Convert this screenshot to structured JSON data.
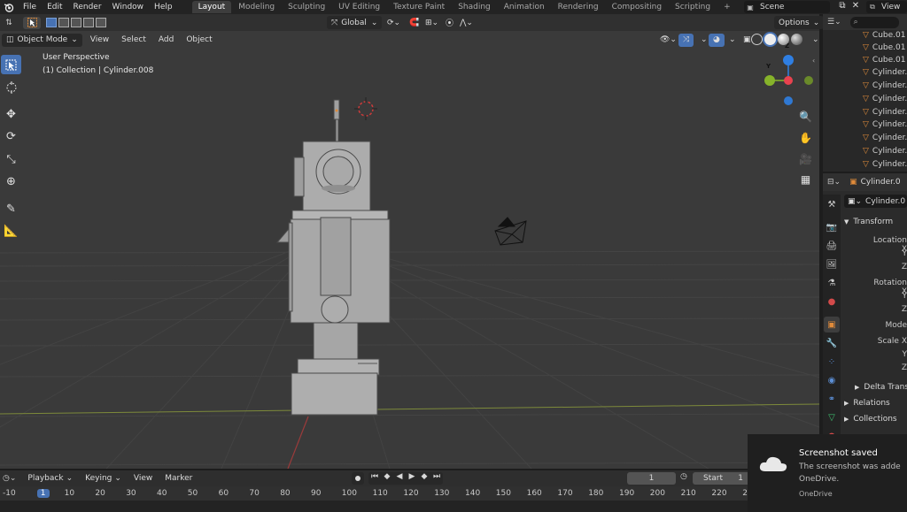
{
  "menubar": {
    "menus": [
      "File",
      "Edit",
      "Render",
      "Window",
      "Help"
    ],
    "workspaces": [
      "Layout",
      "Modeling",
      "Sculpting",
      "UV Editing",
      "Texture Paint",
      "Shading",
      "Animation",
      "Rendering",
      "Compositing",
      "Scripting"
    ],
    "add_workspace": "+",
    "scene_label": "Scene",
    "view_layer_label": "View"
  },
  "viewport_header": {
    "mode": "Object Mode",
    "menus": [
      "View",
      "Select",
      "Add",
      "Object"
    ],
    "transform_orientation": "Global",
    "options_label": "Options"
  },
  "viewport": {
    "perspective_label": "User Perspective",
    "collection_label": "(1) Collection | Cylinder.008",
    "gizmo": {
      "z": "Z",
      "y": "Y"
    }
  },
  "outliner": {
    "items": [
      "Cube.01",
      "Cube.01",
      "Cube.01",
      "Cylinder.",
      "Cylinder.",
      "Cylinder.",
      "Cylinder.",
      "Cylinder.",
      "Cylinder.",
      "Cylinder.",
      "Cylinder."
    ]
  },
  "properties": {
    "object_name_field": "Cylinder.0",
    "object_name_header": "Cylinder.0",
    "transform_label": "Transform",
    "location_x": "Location X",
    "location_y": "Y",
    "location_z": "Z",
    "rotation_x": "Rotation X",
    "rotation_y": "Y",
    "rotation_z": "Z",
    "mode_label": "Mode",
    "scale_x": "Scale X",
    "scale_y": "Y",
    "scale_z": "Z",
    "delta_transform": "Delta Transfo",
    "relations": "Relations",
    "collections": "Collections"
  },
  "timeline": {
    "menus": [
      "Playback",
      "Keying",
      "View",
      "Marker"
    ],
    "current_frame": "1",
    "start_label": "Start",
    "start_value": "1",
    "ruler_ticks": [
      "-10",
      "1",
      "10",
      "20",
      "30",
      "40",
      "50",
      "60",
      "70",
      "80",
      "90",
      "100",
      "110",
      "120",
      "130",
      "140",
      "150",
      "160",
      "170",
      "180",
      "190",
      "200",
      "210",
      "220",
      "2"
    ]
  },
  "notification": {
    "title": "Screenshot saved",
    "body": "The screenshot was adde OneDrive.",
    "source": "OneDrive"
  },
  "colors": {
    "accent": "#4772b3",
    "axis_x": "#e8424f",
    "axis_y": "#86b32a",
    "axis_z": "#2f7fe3",
    "object_orange": "#e08b3a"
  }
}
